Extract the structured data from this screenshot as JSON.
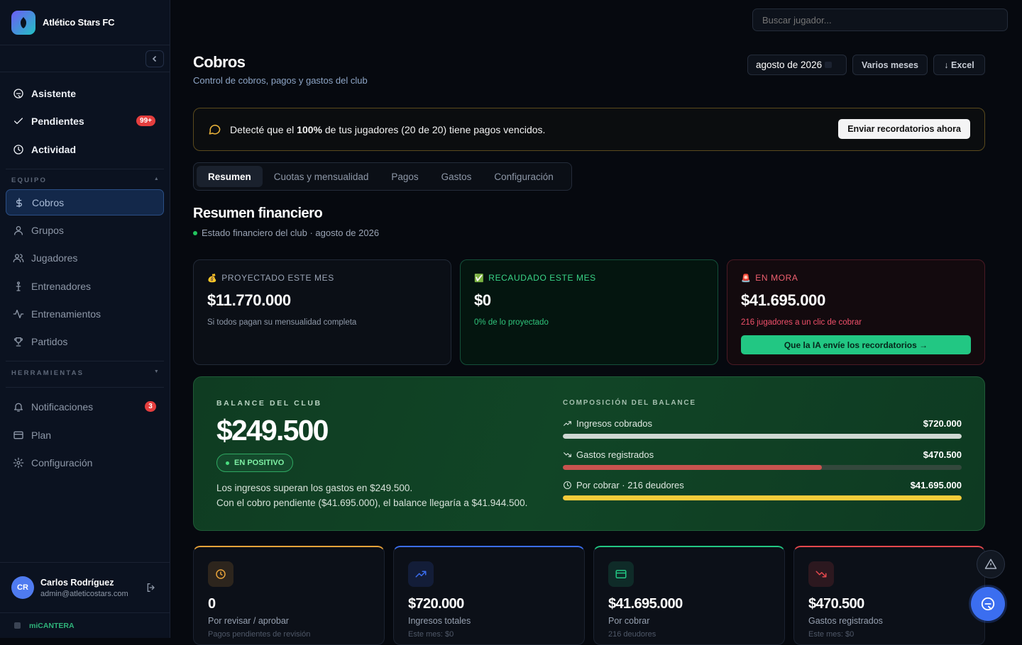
{
  "brand": {
    "name": "Atlético Stars FC",
    "logo_icon": "club-logo-icon"
  },
  "sidebar": {
    "top_items": [
      {
        "label": "Asistente",
        "icon": "chat-icon"
      },
      {
        "label": "Pendientes",
        "icon": "check-icon",
        "badge": "99+"
      },
      {
        "label": "Actividad",
        "icon": "clock-icon"
      }
    ],
    "equipo_label": "EQUIPO",
    "equipo_items": [
      {
        "label": "Cobros",
        "icon": "dollar-icon",
        "active": true
      },
      {
        "label": "Grupos",
        "icon": "user-icon"
      },
      {
        "label": "Jugadores",
        "icon": "users-icon"
      },
      {
        "label": "Entrenadores",
        "icon": "whistle-icon"
      },
      {
        "label": "Entrenamientos",
        "icon": "activity-icon"
      },
      {
        "label": "Partidos",
        "icon": "trophy-icon"
      }
    ],
    "herramientas_label": "HERRAMIENTAS",
    "herramientas_items": [
      {
        "label": "Notificaciones",
        "icon": "bell-icon",
        "badge": "3"
      },
      {
        "label": "Plan",
        "icon": "card-icon"
      },
      {
        "label": "Configuración",
        "icon": "gear-icon"
      }
    ]
  },
  "user": {
    "initials": "CR",
    "name": "Carlos Rodríguez",
    "email": "admin@atleticostars.com"
  },
  "footer_brand": "miCANTERA",
  "search": {
    "placeholder": "Buscar jugador..."
  },
  "header": {
    "title": "Cobros",
    "subtitle": "Control de cobros, pagos y gastos del club",
    "month": "agosto de 2026",
    "multi_month": "Varios meses",
    "excel": "↓ Excel"
  },
  "alert": {
    "text_before": "Detecté que el ",
    "percent": "100%",
    "text_after": " de tus jugadores (20 de 20) tiene pagos vencidos.",
    "button": "Enviar recordatorios ahora"
  },
  "tabs": [
    "Resumen",
    "Cuotas y mensualidad",
    "Pagos",
    "Gastos",
    "Configuración"
  ],
  "summary": {
    "title": "Resumen financiero",
    "subtitle": "Estado financiero del club · agosto de 2026"
  },
  "cards": {
    "proyectado": {
      "emoji": "💰",
      "label": "PROYECTADO ESTE MES",
      "value": "$11.770.000",
      "note": "Si todos pagan su mensualidad completa"
    },
    "recaudado": {
      "emoji": "✅",
      "label": "RECAUDADO ESTE MES",
      "value": "$0",
      "note": "0% de lo proyectado"
    },
    "mora": {
      "emoji": "🚨",
      "label": "EN MORA",
      "value": "$41.695.000",
      "note": "216 jugadores a un clic de cobrar",
      "button": "Que la IA envíe los recordatorios →"
    }
  },
  "balance": {
    "label": "BALANCE DEL CLUB",
    "value": "$249.500",
    "status": "EN POSITIVO",
    "line1": "Los ingresos superan los gastos en $249.500.",
    "line2": "Con el cobro pendiente ($41.695.000), el balance llegaría a $41.944.500.",
    "composition_label": "COMPOSICIÓN DEL BALANCE",
    "rows": [
      {
        "label": "Ingresos cobrados",
        "amount": "$720.000",
        "fill": 1.0,
        "color": "#cfd8d2"
      },
      {
        "label": "Gastos registrados",
        "amount": "$470.500",
        "fill": 0.65,
        "color": "#c9534f"
      },
      {
        "label": "Por cobrar · 216 deudores",
        "amount": "$41.695.000",
        "fill": 1.0,
        "color": "#f5cc3a"
      }
    ]
  },
  "kpis": [
    {
      "value": "0",
      "label": "Por revisar / aprobar",
      "sub": "Pagos pendientes de revisión",
      "icon": "clock-icon",
      "accent": "#e8a33a"
    },
    {
      "value": "$720.000",
      "label": "Ingresos totales",
      "sub": "Este mes: $0",
      "icon": "trending-up-icon",
      "accent": "#3b6ef0"
    },
    {
      "value": "$41.695.000",
      "label": "Por cobrar",
      "sub": "216 deudores",
      "icon": "card-icon",
      "accent": "#22c783"
    },
    {
      "value": "$470.500",
      "label": "Gastos registrados",
      "sub": "Este mes: $0",
      "icon": "trending-down-icon",
      "accent": "#e5484d"
    }
  ]
}
